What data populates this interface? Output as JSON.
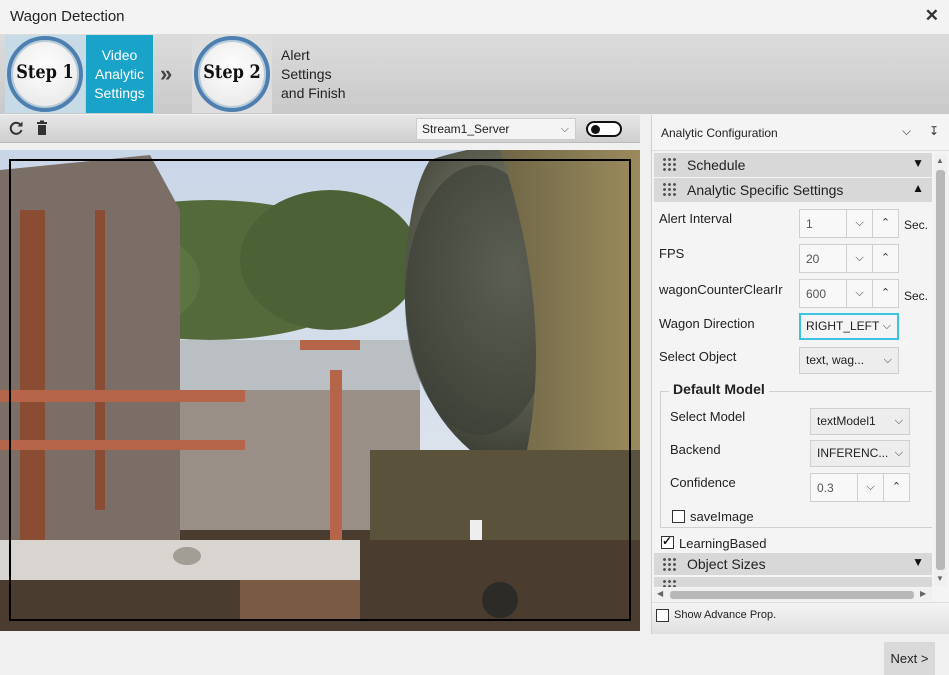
{
  "window": {
    "title": "Wagon Detection",
    "close_glyph": "✕"
  },
  "steps": [
    {
      "badge": "Step 1",
      "label": "Video Analytic Settings",
      "active": true
    },
    {
      "badge": "Step 2",
      "label": "Alert Settings and Finish",
      "active": false
    }
  ],
  "steps_separator": "»",
  "video_toolbar": {
    "icons": [
      "refresh-icon",
      "trash-icon"
    ],
    "stream": "Stream1_Server",
    "toggle_on": false
  },
  "panel": {
    "title": "Analytic Configuration",
    "categories": {
      "schedule": "Schedule",
      "analytic": "Analytic Specific Settings",
      "object_sizes": "Object Sizes"
    },
    "props": {
      "alert_interval": {
        "name": "Alert Interval",
        "value": "1",
        "unit": "Sec."
      },
      "fps": {
        "name": "FPS",
        "value": "20"
      },
      "wagon_counter": {
        "name": "wagonCounterClearIr",
        "value": "600",
        "unit": "Sec."
      },
      "wagon_direction": {
        "name": "Wagon Direction",
        "value": "RIGHT_LEFT"
      },
      "select_object": {
        "name": "Select Object",
        "value": "text, wag..."
      }
    },
    "default_model": {
      "title": "Default Model",
      "select_model": {
        "name": "Select Model",
        "value": "textModel1"
      },
      "backend": {
        "name": "Backend",
        "value": "INFERENC..."
      },
      "confidence": {
        "name": "Confidence",
        "value": "0.3"
      },
      "save_image": {
        "label": "saveImage",
        "checked": false
      }
    },
    "learning_based": {
      "label": "LearningBased",
      "checked": true
    },
    "show_advance": {
      "label": "Show Advance Prop.",
      "checked": false
    }
  },
  "footer": {
    "next": "Next >"
  }
}
